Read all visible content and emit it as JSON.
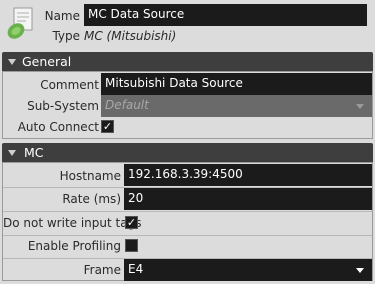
{
  "header": {
    "name_label": "Name",
    "name_value": "MC Data Source",
    "type_label": "Type",
    "type_value": "MC (Mitsubishi)",
    "icon": "data-source-icon"
  },
  "general": {
    "title": "General",
    "comment_label": "Comment",
    "comment_value": "Mitsubishi Data Source",
    "subsystem_label": "Sub-System",
    "subsystem_value": "Default",
    "autoconnect_label": "Auto Connect",
    "autoconnect_checked": true
  },
  "mc": {
    "title": "MC",
    "hostname_label": "Hostname",
    "hostname_value": "192.168.3.39:4500",
    "rate_label": "Rate (ms)",
    "rate_value": "20",
    "no_write_label": "Do not write input tags",
    "no_write_checked": true,
    "profiling_label": "Enable Profiling",
    "profiling_checked": false,
    "frame_label": "Frame",
    "frame_value": "E4"
  },
  "colors": {
    "field_bg": "#1b1b1b",
    "section_bg": "#3e3e3e",
    "panel_bg": "#dcdcdc",
    "icon_green": "#6ab04c"
  }
}
